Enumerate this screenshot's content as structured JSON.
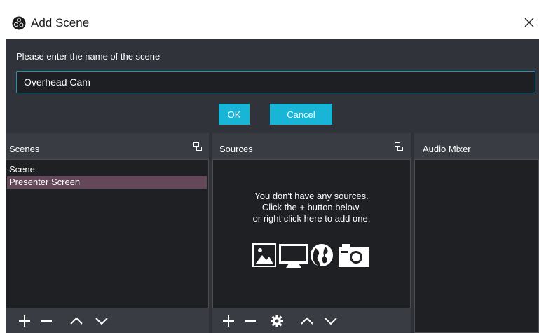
{
  "window": {
    "title": "Add Scene",
    "close_label": "×"
  },
  "dialog": {
    "prompt": "Please enter the name of the scene",
    "input_value": "Overhead Cam",
    "ok_label": "OK",
    "cancel_label": "Cancel",
    "accent_color": "#18b5d6"
  },
  "docks": {
    "scenes": {
      "title": "Scenes",
      "items": [
        "Scene",
        "Presenter Screen"
      ],
      "selected_index": 1
    },
    "sources": {
      "title": "Sources",
      "empty_line1": "You don't have any sources.",
      "empty_line2": "Click the + button below,",
      "empty_line3": "or right click here to add one.",
      "icons": [
        "image-icon",
        "display-icon",
        "globe-icon",
        "camera-icon"
      ]
    },
    "audio_mixer": {
      "title": "Audio Mixer"
    }
  }
}
